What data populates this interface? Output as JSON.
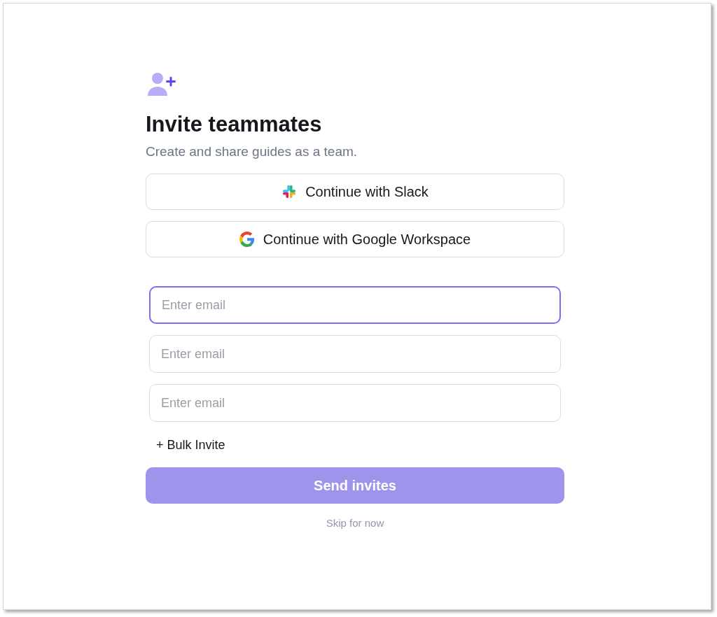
{
  "title": "Invite teammates",
  "subtitle": "Create and share guides as a team.",
  "providers": [
    {
      "kind": "slack",
      "label": "Continue with Slack"
    },
    {
      "kind": "google",
      "label": "Continue with Google Workspace"
    }
  ],
  "email_fields": [
    {
      "placeholder": "Enter email",
      "focused": true
    },
    {
      "placeholder": "Enter email",
      "focused": false
    },
    {
      "placeholder": "Enter email",
      "focused": false
    }
  ],
  "bulk_invite": "+ Bulk Invite",
  "send_button": {
    "label": "Send invites",
    "disabled": true
  },
  "skip_link": "Skip for now"
}
